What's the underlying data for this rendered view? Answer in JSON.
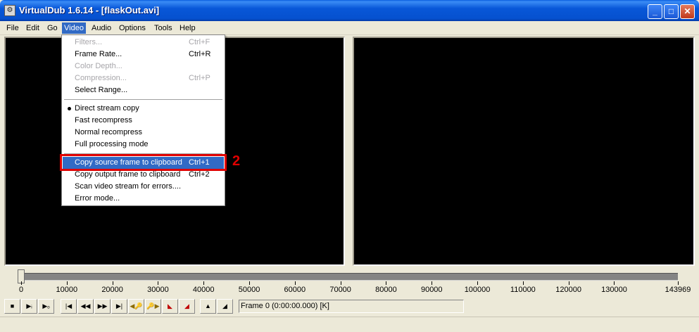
{
  "window": {
    "title": "VirtualDub 1.6.14 - [flaskOut.avi]"
  },
  "menubar": [
    "File",
    "Edit",
    "Go",
    "Video",
    "Audio",
    "Options",
    "Tools",
    "Help"
  ],
  "video_menu": {
    "items": [
      {
        "label": "Filters...",
        "shortcut": "Ctrl+F",
        "disabled": true
      },
      {
        "label": "Frame Rate...",
        "shortcut": "Ctrl+R"
      },
      {
        "label": "Color Depth...",
        "shortcut": "",
        "disabled": true
      },
      {
        "label": "Compression...",
        "shortcut": "Ctrl+P",
        "disabled": true
      },
      {
        "label": "Select Range...",
        "shortcut": ""
      },
      {
        "label": "Direct stream copy",
        "shortcut": "",
        "checked": true
      },
      {
        "label": "Fast recompress",
        "shortcut": ""
      },
      {
        "label": "Normal recompress",
        "shortcut": ""
      },
      {
        "label": "Full processing mode",
        "shortcut": ""
      },
      {
        "label": "Copy source frame to clipboard",
        "shortcut": "Ctrl+1",
        "selected": true
      },
      {
        "label": "Copy output frame to clipboard",
        "shortcut": "Ctrl+2"
      },
      {
        "label": "Scan video stream for errors....",
        "shortcut": ""
      },
      {
        "label": "Error mode...",
        "shortcut": ""
      }
    ]
  },
  "annotation": {
    "step": "2",
    "color": "#e00000"
  },
  "timeline": {
    "ticks": [
      "0",
      "10000",
      "20000",
      "30000",
      "40000",
      "50000",
      "60000",
      "70000",
      "80000",
      "90000",
      "100000",
      "110000",
      "120000",
      "130000",
      "143969"
    ],
    "position": 0,
    "max": 143969
  },
  "transport": {
    "buttons": [
      {
        "icon": "stop-icon",
        "glyph": "■"
      },
      {
        "icon": "play-input-icon",
        "glyph": "▶ᵢ"
      },
      {
        "icon": "play-output-icon",
        "glyph": "▶ₒ"
      },
      {
        "icon": "go-start-icon",
        "glyph": "|◀"
      },
      {
        "icon": "step-back-icon",
        "glyph": "◀◀"
      },
      {
        "icon": "step-forward-icon",
        "glyph": "▶▶"
      },
      {
        "icon": "go-end-icon",
        "glyph": "▶|"
      },
      {
        "icon": "prev-keyframe-icon",
        "glyph": "◀🔑"
      },
      {
        "icon": "next-keyframe-icon",
        "glyph": "🔑▶"
      },
      {
        "icon": "scene-back-icon",
        "glyph": "◣"
      },
      {
        "icon": "scene-forward-icon",
        "glyph": "◢"
      },
      {
        "icon": "mark-in-icon",
        "glyph": "▲"
      },
      {
        "icon": "mark-out-icon",
        "glyph": "◢"
      }
    ],
    "frame_text": "Frame 0 (0:00:00.000) [K]"
  },
  "colors": {
    "menu_highlight": "#316ac5",
    "title_bar": "#0857d8"
  }
}
